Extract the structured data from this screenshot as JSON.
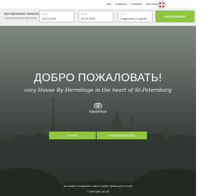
{
  "nav": {
    "items": [
      "Нас",
      "Комнаты",
      "Галерея",
      "Контакты"
    ]
  },
  "booking": {
    "title": "Бронирование номеров",
    "subtitle": "Гарантированное заселение",
    "checkin_label": "Заезд",
    "checkin_value": "19.10.2020",
    "checkout_label": "Выезд",
    "checkout_value": "20.10.2020",
    "guests_label": "Гости",
    "guests_value": "2 взрослых, 0 детей",
    "search_label": "НАЙТИ НОМЕР"
  },
  "hero": {
    "title": "ДОБРО ПОЖАЛОВАТЬ!",
    "subtitle": "cozy House By Hermitage in the heart of St.Petersburg",
    "tripadvisor": "tripadvisor",
    "about_label": "О НАС",
    "rooms_label": "НАШИ КОМНАТЫ"
  },
  "footer": {
    "note": "вы можете позвонить нам в любое время дня и ночи",
    "phone": "+7(981)890-82-85"
  },
  "colors": {
    "accent": "#8ec63f"
  }
}
